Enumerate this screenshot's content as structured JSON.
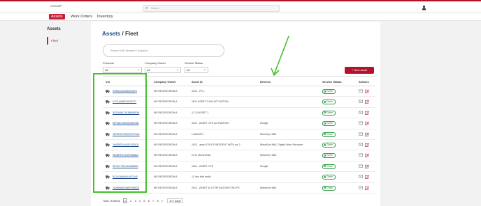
{
  "brand": "CREMA",
  "search_placeholder": "Search...",
  "nav": {
    "assets": "Assets",
    "work_orders": "Work Orders",
    "inventory": "Inventory"
  },
  "sidebar": {
    "title": "Assets",
    "items": [
      {
        "label": "Fleet"
      }
    ]
  },
  "breadcrumb": {
    "section": "Assets",
    "separator": "/",
    "page": "Fleet"
  },
  "vin_search_placeholder": "Search VIN Number / Asset Id",
  "filters": [
    {
      "label": "Products",
      "value": "All"
    },
    {
      "label": "Company Owner",
      "value": "All"
    },
    {
      "label": "Service Status",
      "value": "All"
    }
  ],
  "new_asset_label": "+ New asset",
  "columns": [
    "Vin",
    "Company Owner",
    "Asset Id",
    "Devices",
    "Service Status",
    "Actions"
  ],
  "rows": [
    {
      "vin": "ZHMGJ40A65013576",
      "owner": "MS REGRESSION A",
      "asset_id": "1612 - FE 1",
      "devices": "",
      "status": "Green"
    },
    {
      "vin": "1YV1AM8221023377",
      "owner": "MS REGRESSION A",
      "asset_id": "1612 ASSET 2 WO ACTIVATION",
      "devices": "",
      "status": "Green"
    },
    {
      "vin": "3GCWAA71K0B063538",
      "owner": "MS REGRESSION A",
      "asset_id": "12 12 ASSET 1",
      "devices": "",
      "status": "Green"
    },
    {
      "vin": "WP0AC2964SS890785",
      "owner": "MS REGRESSION A",
      "asset_id": "1612 - ASSET 4 FE ACTIVATION",
      "devices": "Dongle",
      "status": "Green"
    },
    {
      "vin": "JHFBTK730KD7077344",
      "owner": "MS REGRESSION A",
      "asset_id": "LOADMV1",
      "devices": "MirrorEye Mk2",
      "status": "Green"
    },
    {
      "vin": "1HGBP3UU02F433102",
      "owner": "MS REGRESSION A",
      "asset_id": "1612 - asset 2 ID FE INCIDENT WITH wo 2",
      "devices": "MirrorEye Mk2, Digital Video Recorder",
      "status": "Green"
    },
    {
      "vin": "WDBRF61J20F068863",
      "owner": "MS REGRESSION A",
      "asset_id": "2712 MovieTest6",
      "devices": "MirrorEye Mk2",
      "status": "Green"
    },
    {
      "vin": "3KTUY7D241A658892",
      "owner": "MS REGRESSION A",
      "asset_id": "1612 - ASSET 3 FE",
      "devices": "Dongle",
      "status": "Green"
    },
    {
      "vin": "5CA1188A44U637440",
      "owner": "MS REGRESSION A",
      "asset_id": "12 dec fefe tardio",
      "devices": "",
      "status": "Green"
    },
    {
      "vin": "2AXNNMD3B0F008020",
      "owner": "MS REGRESSION A",
      "asset_id": "2012 - ASSET id 3 FOR INCIDENT WO FE",
      "devices": "MirrorEye Mk2",
      "status": "Green"
    }
  ],
  "pagination": {
    "total_label": "Total 75 items",
    "pages": [
      "1",
      "2",
      "3",
      "4",
      "5",
      "6",
      "7",
      "8"
    ],
    "next": ">",
    "page_size": "10 / page"
  },
  "colors": {
    "brand": "#b3122a",
    "highlight": "#44c12b",
    "link": "#1f4d8c",
    "status_green": "#2e9e45"
  }
}
